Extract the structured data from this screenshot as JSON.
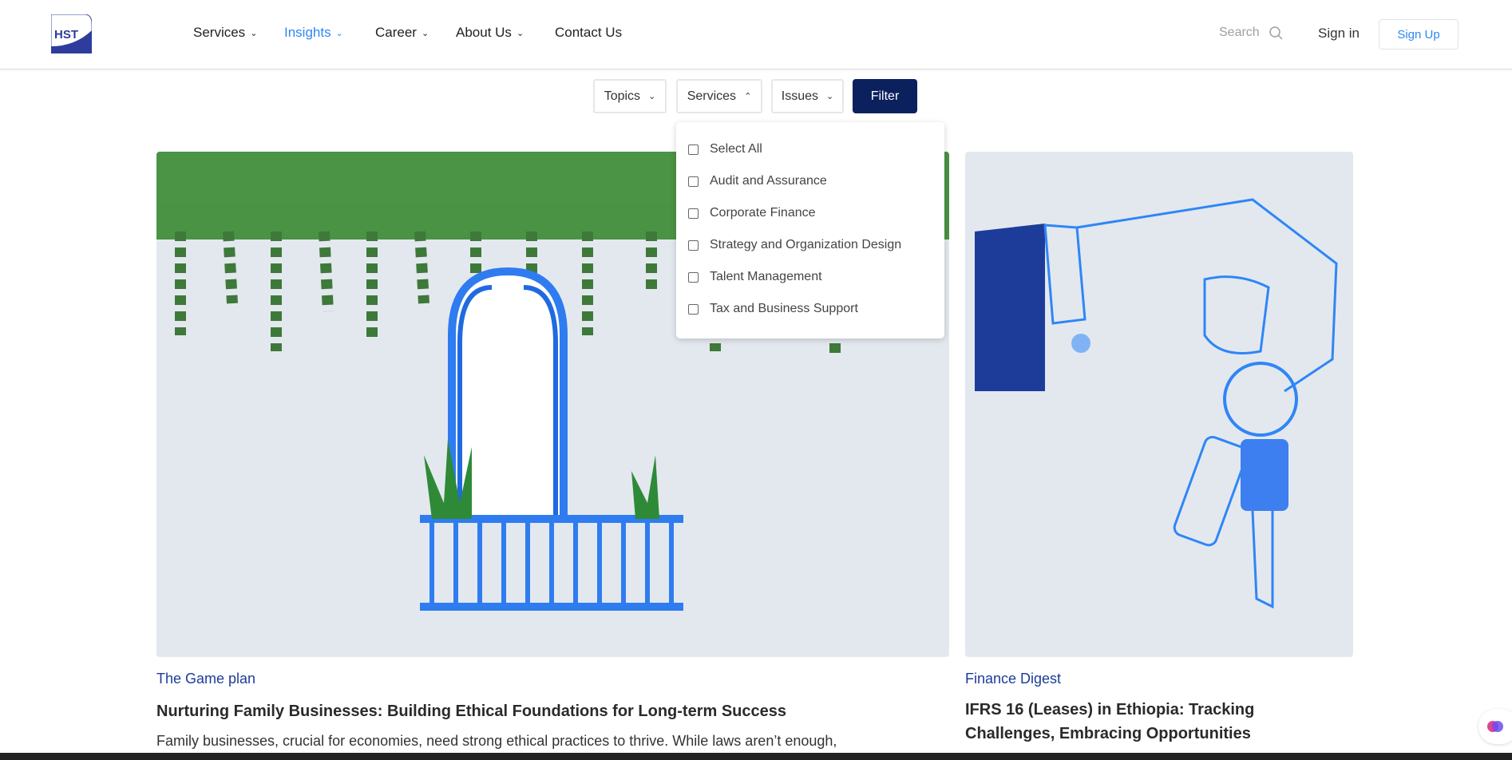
{
  "header": {
    "logo_text": "HST",
    "nav": [
      {
        "label": "Services",
        "active": false
      },
      {
        "label": "Insights",
        "active": true
      },
      {
        "label": "Career",
        "active": false
      },
      {
        "label": "About Us",
        "active": false
      },
      {
        "label": "Contact Us",
        "active": false
      }
    ],
    "search_label": "Search",
    "signin_label": "Sign in",
    "signup_label": "Sign Up"
  },
  "filters": {
    "topics_label": "Topics",
    "services_label": "Services",
    "issues_label": "Issues",
    "filter_label": "Filter",
    "services_options": [
      "Select All",
      "Audit and Assurance",
      "Corporate Finance",
      "Strategy and Organization Design",
      "Talent Management",
      "Tax and Business Support"
    ]
  },
  "cards": [
    {
      "category": "The Game plan",
      "title": "Nurturing Family Businesses: Building Ethical Foundations for Long-term Success",
      "excerpt": "Family businesses, crucial for economies, need strong ethical practices to thrive. While laws aren’t enough,"
    },
    {
      "category": "Finance Digest",
      "title_line1": "IFRS 16 (Leases) in Ethiopia: Tracking",
      "title_line2": "Challenges, Embracing Opportunities"
    }
  ],
  "colors": {
    "accent": "#2f86f6",
    "brand_navy": "#0b215e",
    "category": "#1d3c9a"
  }
}
